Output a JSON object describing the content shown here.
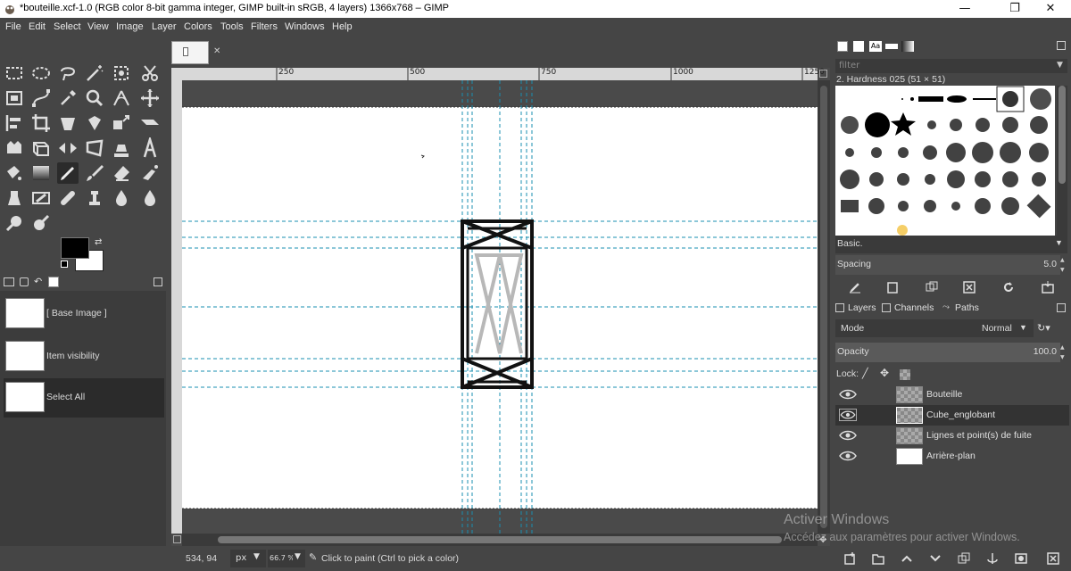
{
  "window": {
    "title": "*bouteille.xcf-1.0 (RGB color 8-bit gamma integer, GIMP built-in sRGB, 4 layers) 1366x768 – GIMP",
    "minimize": "—",
    "maximize": "❐",
    "close": "✕"
  },
  "menubar": [
    "File",
    "Edit",
    "Select",
    "View",
    "Image",
    "Layer",
    "Colors",
    "Tools",
    "Filters",
    "Windows",
    "Help"
  ],
  "image_tab": {
    "close": "✕"
  },
  "ruler": {
    "h_ticks": [
      "250",
      "500",
      "750",
      "1000",
      "1250"
    ]
  },
  "history": {
    "items": [
      {
        "label": "[ Base Image ]"
      },
      {
        "label": "Item visibility"
      },
      {
        "label": "Select All"
      }
    ]
  },
  "statusbar": {
    "coords": "534, 94",
    "unit": "px",
    "zoom": "66.7 %",
    "message": "Click to paint (Ctrl to pick a color)"
  },
  "brushes": {
    "filter_placeholder": "filter",
    "selected": "2. Hardness 025 (51 × 51)",
    "preset": "Basic.",
    "spacing_label": "Spacing",
    "spacing_value": "5.0"
  },
  "layers_panel": {
    "tabs": [
      "Layers",
      "Channels",
      "Paths"
    ],
    "mode_label": "Mode",
    "mode_value": "Normal",
    "opacity_label": "Opacity",
    "opacity_value": "100.0",
    "lock_label": "Lock:",
    "layers": [
      {
        "name": "Bouteille",
        "visible": true,
        "thumb": "checker"
      },
      {
        "name": "Cube_englobant",
        "visible": true,
        "thumb": "checker"
      },
      {
        "name": "Lignes et point(s) de fuite",
        "visible": true,
        "thumb": "checker"
      },
      {
        "name": "Arrière-plan",
        "visible": true,
        "thumb": "white"
      }
    ]
  },
  "watermark": {
    "line1": "Activer Windows",
    "line2": "Accédez aux paramètres pour activer Windows."
  },
  "colors": {
    "foreground": "#000000",
    "background": "#ffffff",
    "guide": "#1a8fb0",
    "ui_bg": "#454545"
  }
}
